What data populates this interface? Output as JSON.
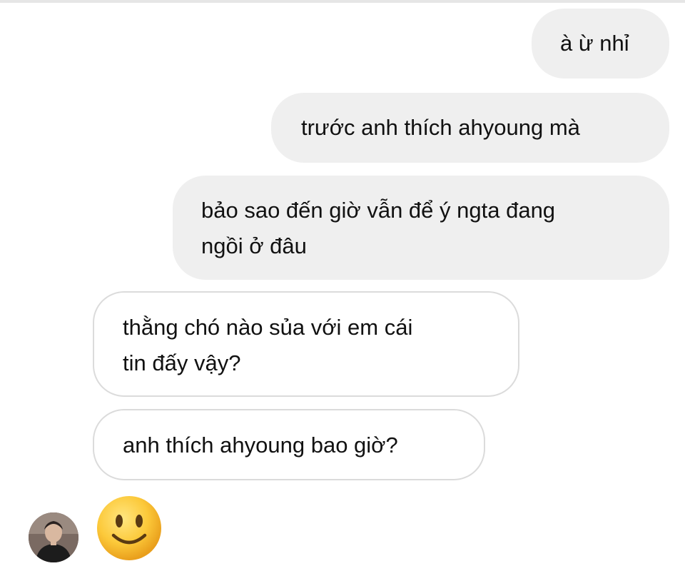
{
  "conversation": {
    "messages": [
      {
        "side": "sent",
        "text": "à ừ nhỉ"
      },
      {
        "side": "sent",
        "text": "trước anh thích ahyoung mà"
      },
      {
        "side": "sent",
        "text": "bảo sao đến giờ vẫn để ý ngta đang\nngồi ở đâu"
      },
      {
        "side": "received",
        "text": "thằng chó nào sủa với em cái\ntin đấy vậy?"
      },
      {
        "side": "received",
        "text": "anh thích ahyoung bao giờ?"
      }
    ],
    "emoji_reply": "slightly-smiling-face-icon",
    "avatar": "contact-avatar"
  },
  "colors": {
    "sent_bubble": "#efefef",
    "received_border": "#dbdbdb",
    "text": "#111111"
  }
}
